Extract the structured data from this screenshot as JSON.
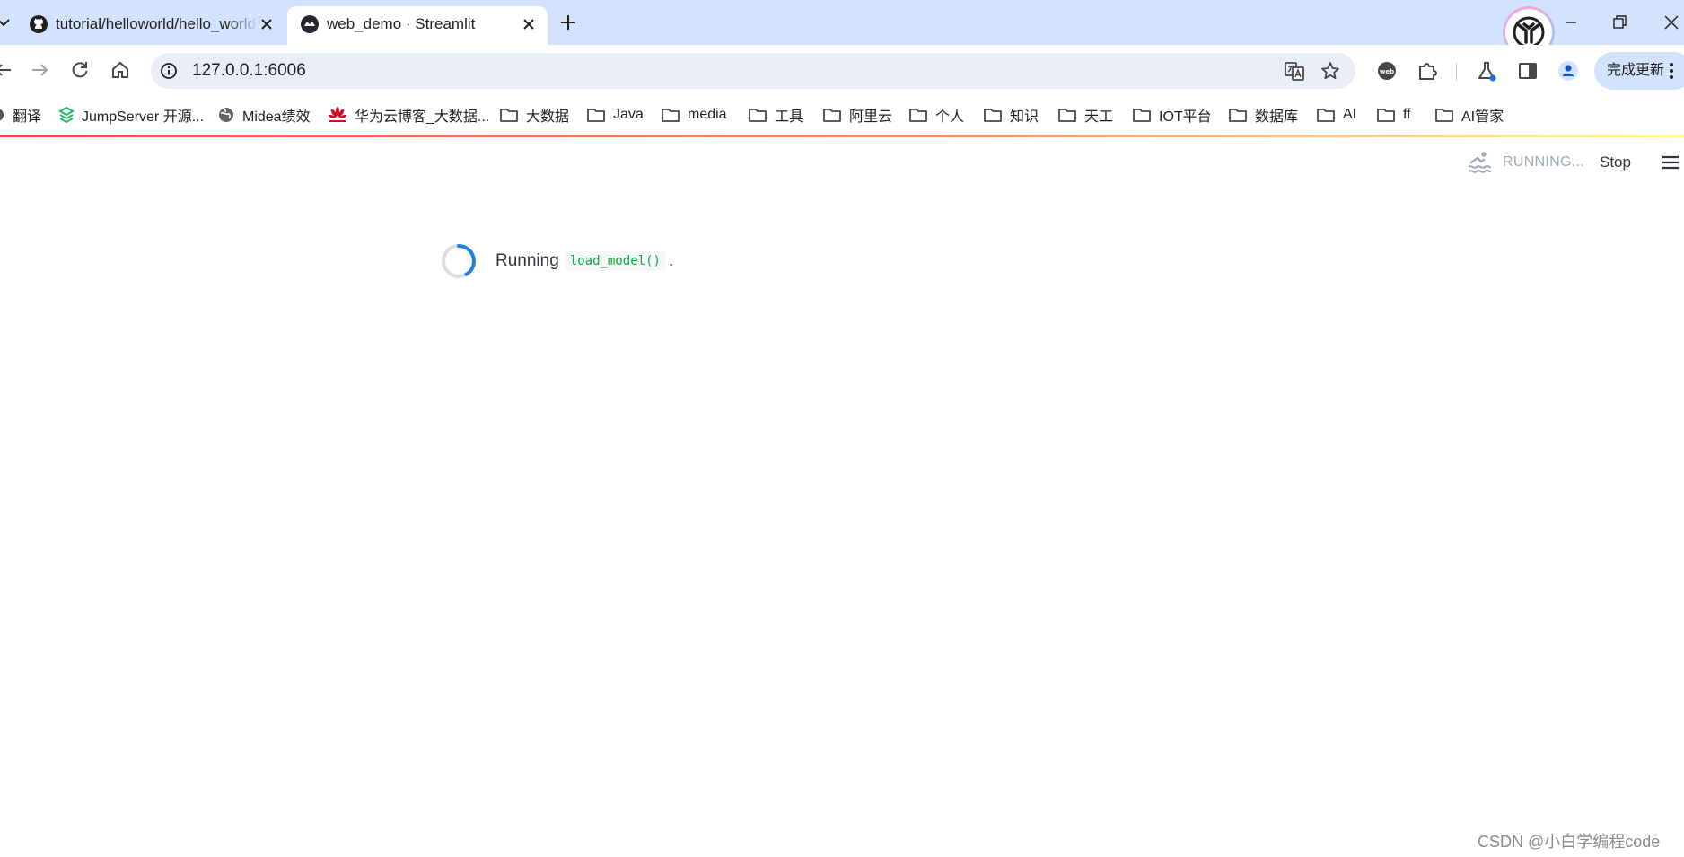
{
  "browser": {
    "tabs": [
      {
        "title": "tutorial/helloworld/hello_world",
        "favicon": "github-icon",
        "active": false
      },
      {
        "title": "web_demo · Streamlit",
        "favicon": "streamlit-icon",
        "active": true
      }
    ],
    "address": {
      "url": "127.0.0.1:6006"
    },
    "update_button": "完成更新",
    "bookmarks": [
      {
        "label": "翻译",
        "icon": "translate-icon"
      },
      {
        "label": "JumpServer 开源...",
        "icon": "jumpserver-icon"
      },
      {
        "label": "Midea绩效",
        "icon": "globe-icon"
      },
      {
        "label": "华为云博客_大数据...",
        "icon": "huawei-icon"
      },
      {
        "label": "大数据",
        "icon": "folder-icon"
      },
      {
        "label": "Java",
        "icon": "folder-icon"
      },
      {
        "label": "media",
        "icon": "folder-icon"
      },
      {
        "label": "工具",
        "icon": "folder-icon"
      },
      {
        "label": "阿里云",
        "icon": "folder-icon"
      },
      {
        "label": "个人",
        "icon": "folder-icon"
      },
      {
        "label": "知识",
        "icon": "folder-icon"
      },
      {
        "label": "天工",
        "icon": "folder-icon"
      },
      {
        "label": "IOT平台",
        "icon": "folder-icon"
      },
      {
        "label": "数据库",
        "icon": "folder-icon"
      },
      {
        "label": "AI",
        "icon": "folder-icon"
      },
      {
        "label": "ff",
        "icon": "folder-icon"
      },
      {
        "label": "AI管家",
        "icon": "folder-icon"
      }
    ]
  },
  "streamlit": {
    "status_label": "RUNNING...",
    "stop_label": "Stop",
    "running_text": "Running",
    "function_code": "load_model()",
    "trailing": ".",
    "colors": {
      "accent": "#ff4b4b",
      "code": "#09ab3b",
      "spinner": "#1c83e1"
    }
  },
  "watermark": "CSDN @小白学编程code"
}
